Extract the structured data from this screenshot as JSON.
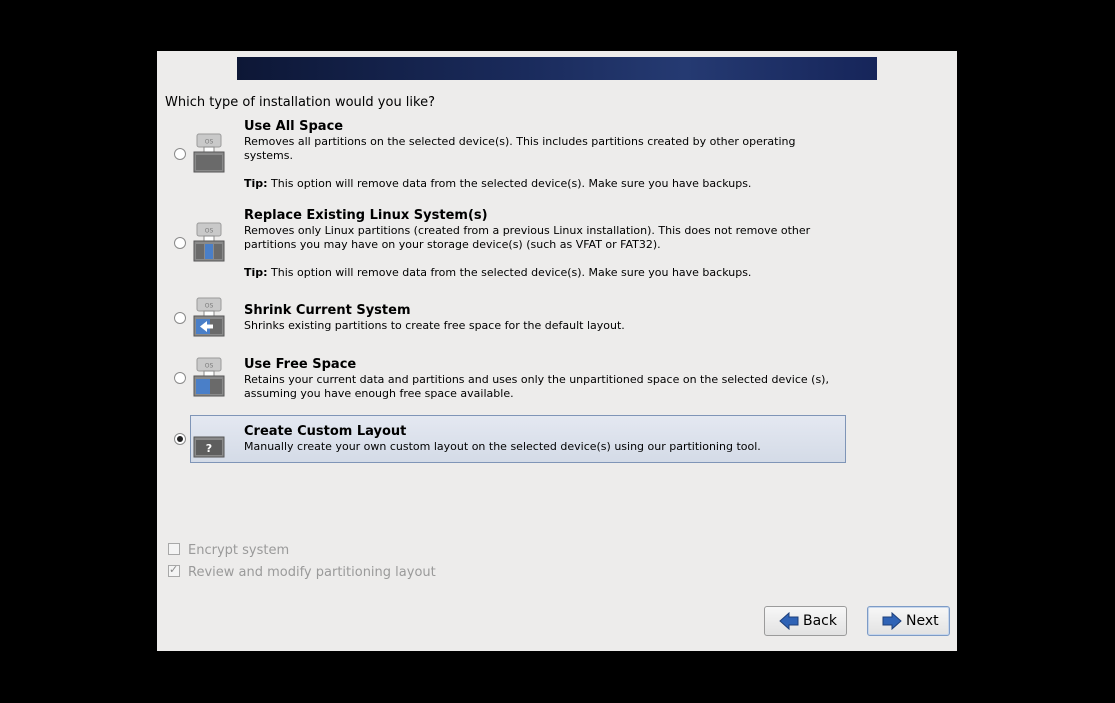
{
  "question": "Which type of installation would you like?",
  "options": [
    {
      "title": "Use All Space",
      "desc": "Removes all partitions on the selected device(s).  This includes partitions created by other operating systems.",
      "tip_label": "Tip:",
      "tip": "This option will remove data from the selected device(s).  Make sure you have backups.",
      "icon_text": "OS",
      "selected": false
    },
    {
      "title": "Replace Existing Linux System(s)",
      "desc": "Removes only Linux partitions (created from a previous Linux installation).  This does not remove other partitions you may have on your storage device(s) (such as VFAT or FAT32).",
      "tip_label": "Tip:",
      "tip": "This option will remove data from the selected device(s).  Make sure you have backups.",
      "icon_text": "OS",
      "selected": false
    },
    {
      "title": "Shrink Current System",
      "desc": "Shrinks existing partitions to create free space for the default layout.",
      "icon_text": "OS",
      "selected": false
    },
    {
      "title": "Use Free Space",
      "desc": "Retains your current data and partitions and uses only the unpartitioned space on the selected device (s), assuming you have enough free space available.",
      "icon_text": "OS",
      "selected": false
    },
    {
      "title": "Create Custom Layout",
      "desc": "Manually create your own custom layout on the selected device(s) using our partitioning tool.",
      "icon_text": "?",
      "selected": true
    }
  ],
  "checkboxes": {
    "encrypt": {
      "label": "Encrypt system",
      "checked": false,
      "enabled": false
    },
    "review": {
      "label": "Review and modify partitioning layout",
      "checked": true,
      "enabled": false
    }
  },
  "buttons": {
    "back": "Back",
    "next": "Next"
  },
  "colors": {
    "selection_border": "#7f95b7",
    "arrow_blue": "#2f63b6"
  }
}
